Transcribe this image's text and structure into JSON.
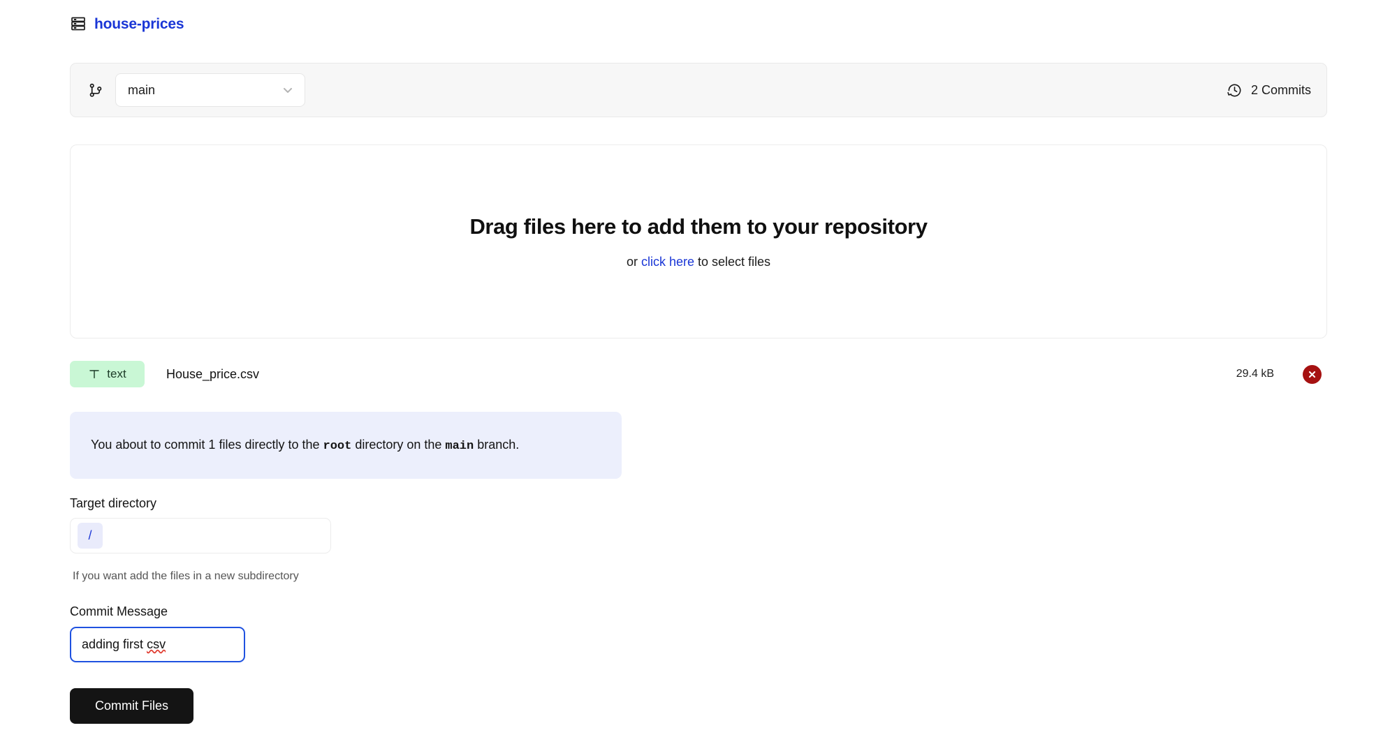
{
  "repo": {
    "icon": "dataset-rows-icon",
    "name": "house-prices",
    "name_color": "#1a36d6"
  },
  "toolbar": {
    "branch_icon": "git-branch-icon",
    "branch_value": "main",
    "chevron_icon": "chevron-down-icon",
    "commits_icon": "history-clock-icon",
    "commits_label": "2 Commits"
  },
  "dropzone": {
    "title": "Drag files here to add them to your repository",
    "sub_prefix": "or ",
    "link_text": "click here",
    "sub_suffix": " to select files"
  },
  "file": {
    "badge_icon": "text-type-icon",
    "badge_label": "text",
    "name": "House_price.csv",
    "size": "29.4 kB",
    "remove_icon": "close-circle-icon",
    "badge_bg": "#c9f7d5",
    "remove_bg": "#a61111"
  },
  "banner": {
    "part1": "You about to commit 1 files directly to the ",
    "dir": "root",
    "part2": " directory on the ",
    "branch": "main",
    "part3": " branch.",
    "bg": "#eceffc"
  },
  "form": {
    "target_label": "Target directory",
    "target_prefix": "/",
    "target_value": "",
    "target_help": "If you want add the files in a new subdirectory",
    "commit_label": "Commit Message",
    "commit_value": "adding first csv",
    "commit_value_head": "adding first ",
    "commit_value_misspelled": "csv",
    "submit_label": "Commit Files",
    "submit_bg": "#141414",
    "focus_color": "#1f52e0"
  }
}
